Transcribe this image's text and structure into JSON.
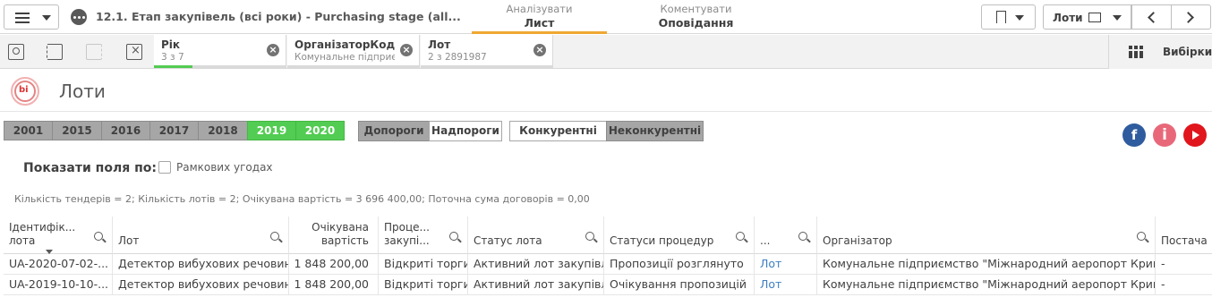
{
  "topbar": {
    "app_title": "12.1. Етап закупівель (всі роки) - Purchasing stage (all...",
    "tabs": [
      {
        "sub": "Аналізувати",
        "main": "Лист"
      },
      {
        "sub": "Коментувати",
        "main": "Оповідання"
      }
    ],
    "sheet_nav_label": "Лоти",
    "active_tab_color": "#f0a732"
  },
  "selections": {
    "chips": [
      {
        "name": "Рік",
        "value": "3 з 7"
      },
      {
        "name": "ОрганізаторКод",
        "value": "Комунальне підприємств..."
      },
      {
        "name": "Лот",
        "value": "2 з 2891987"
      }
    ],
    "selected_fraction_bar": [
      0.43,
      0.0,
      0.0
    ],
    "vybirky_label": "Вибірки",
    "selected_color": "#52cc52"
  },
  "sheet": {
    "logo_text": "bi",
    "title": "Лоти"
  },
  "filters": {
    "years": [
      {
        "label": "2001",
        "selected": false
      },
      {
        "label": "2015",
        "selected": false
      },
      {
        "label": "2016",
        "selected": false
      },
      {
        "label": "2017",
        "selected": false
      },
      {
        "label": "2018",
        "selected": false
      },
      {
        "label": "2019",
        "selected": true
      },
      {
        "label": "2020",
        "selected": true
      }
    ],
    "threshold": [
      {
        "label": "Допороги"
      },
      {
        "label": "Надпороги"
      }
    ],
    "competition": [
      {
        "label": "Конкурентні"
      },
      {
        "label": "Неконкурентні"
      }
    ],
    "social": [
      "facebook-icon",
      "info-icon",
      "youtube-icon"
    ],
    "social_glyphs": {
      "fb": "f",
      "info": "i"
    }
  },
  "show_fields": {
    "label": "Показати поля по:",
    "checkbox_label": "Рамкових угодах"
  },
  "summary": "Кількість тендерів = 2; Кількість лотів = 2; Очікувана вартість = 3 696 400,00; Поточна сума договорів = 0,00",
  "table": {
    "headers": [
      {
        "l1": "Ідентифік...",
        "l2": "лота"
      },
      {
        "l1": "",
        "l2": "Лот"
      },
      {
        "l1": "Очікувана",
        "l2": "вартість"
      },
      {
        "l1": "Проце...",
        "l2": "закупі..."
      },
      {
        "l1": "",
        "l2": "Статус лота"
      },
      {
        "l1": "",
        "l2": "Статуси процедур"
      },
      {
        "l1": "",
        "l2": "..."
      },
      {
        "l1": "",
        "l2": "Організатор"
      },
      {
        "l1": "",
        "l2": "Постача"
      }
    ],
    "rows": [
      [
        "UA-2020-07-02-...",
        "Детектор вибухових речовин",
        "1 848 200,00",
        "Відкриті торги",
        "Активний лот закупівлі",
        "Пропозиції розглянуто",
        "Лот",
        "Комунальне підприємство \"Міжнародний аеропорт Кривий ...",
        "-"
      ],
      [
        "UA-2019-10-10-...",
        "Детектор вибухових речовин",
        "1 848 200,00",
        "Відкриті торги",
        "Активний лот закупівлі",
        "Очікування пропозицій",
        "Лот",
        "Комунальне підприємство \"Міжнародний аеропорт Кривий ...",
        "-"
      ]
    ]
  }
}
